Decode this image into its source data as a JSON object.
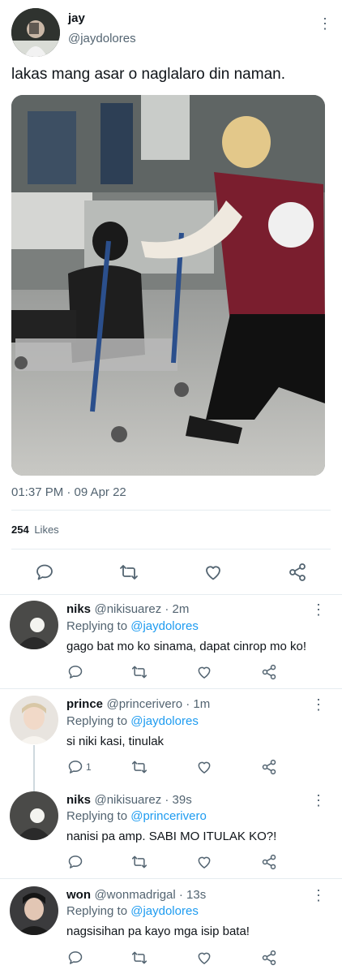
{
  "tweet": {
    "display_name": "jay",
    "handle": "@jaydolores",
    "text": "lakas mang asar o naglalaro din naman.",
    "timestamp": "01:37 PM · 09 Apr 22",
    "likes_count": "254",
    "likes_label": "Likes"
  },
  "actions": {
    "reply_icon": "speech-bubble-icon",
    "retweet_icon": "retweet-icon",
    "like_icon": "heart-icon",
    "share_icon": "share-icon"
  },
  "replies": [
    {
      "name": "niks",
      "meta": "@nikisuarez · 2m",
      "replying_label": "Replying to",
      "replying_to": "@jaydolores",
      "text": "gago bat mo ko sinama, dapat cinrop mo ko!",
      "reply_count": ""
    },
    {
      "name": "prince",
      "meta": "@princerivero · 1m",
      "replying_label": "Replying to",
      "replying_to": "@jaydolores",
      "text": "si niki kasi, tinulak",
      "reply_count": "1"
    },
    {
      "name": "niks",
      "meta": "@nikisuarez · 39s",
      "replying_label": "Replying to",
      "replying_to": "@princerivero",
      "text": "nanisi pa amp. SABI MO ITULAK KO?!",
      "reply_count": ""
    },
    {
      "name": "won",
      "meta": "@wonmadrigal · 13s",
      "replying_label": "Replying to",
      "replying_to": "@jaydolores",
      "text": "nagsisihan pa kayo mga isip bata!",
      "reply_count": ""
    }
  ],
  "colors": {
    "text": "#0f1419",
    "secondary": "#536471",
    "link": "#1d9bf0",
    "divider": "#e6ecf0"
  }
}
